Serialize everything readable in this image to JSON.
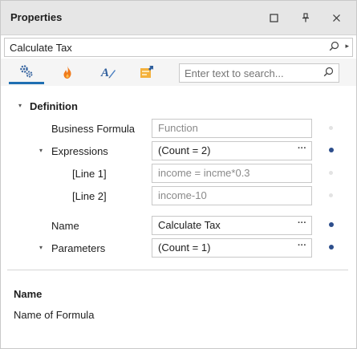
{
  "panel": {
    "title": "Properties",
    "buttons": [
      "maximize",
      "pin",
      "close"
    ]
  },
  "object_selector": {
    "value": "Calculate Tax"
  },
  "toolbar": {
    "tabs": [
      {
        "name": "properties-tab",
        "icon": "gear-icon"
      },
      {
        "name": "events-tab",
        "icon": "fire-icon"
      },
      {
        "name": "appearance-tab",
        "icon": "text-style-icon"
      },
      {
        "name": "quick-actions-tab",
        "icon": "tasks-icon"
      }
    ],
    "search_placeholder": "Enter text to search..."
  },
  "grid": {
    "category": "Definition",
    "rows": [
      {
        "label": "Business Formula",
        "value": "Function",
        "disabled": true,
        "ellipsis": false,
        "modified": false
      },
      {
        "label": "Expressions",
        "value": "(Count = 2)",
        "disabled": false,
        "ellipsis": true,
        "modified": true,
        "expanded": true
      },
      {
        "label": "[Line 1]",
        "value": "income = incme*0.3",
        "disabled": true,
        "ellipsis": false,
        "modified": false
      },
      {
        "label": "[Line 2]",
        "value": "income-10",
        "disabled": true,
        "ellipsis": false,
        "modified": false
      },
      {
        "label": "Name",
        "value": "Calculate Tax",
        "disabled": false,
        "ellipsis": true,
        "modified": true
      },
      {
        "label": "Parameters",
        "value": "(Count = 1)",
        "disabled": false,
        "ellipsis": true,
        "modified": true,
        "expanded": true
      }
    ]
  },
  "description": {
    "title": "Name",
    "text": "Name of Formula"
  },
  "colors": {
    "accent": "#1f6fb2",
    "modified_dot": "#2d4e8c",
    "default_dot": "#e3e3e3"
  }
}
